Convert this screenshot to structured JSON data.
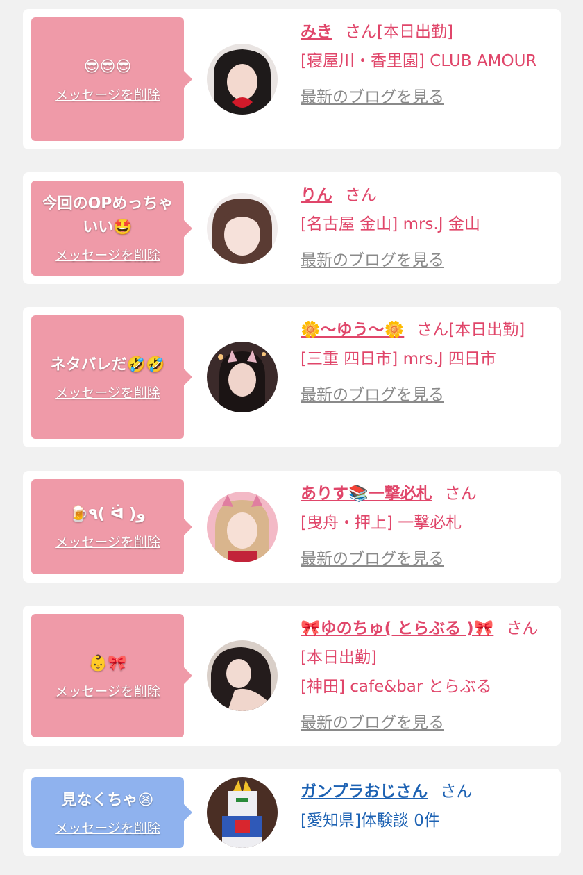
{
  "items": [
    {
      "message": "😎😎😎",
      "delete_label": "メッセージを削除",
      "name": "みき",
      "honorific": "さん[本日出勤]",
      "location": "[寝屋川・香里園] CLUB AMOUR",
      "blog_label": "最新のブログを見る",
      "theme": "pink"
    },
    {
      "message": "今回のOPめっちゃいい🤩",
      "delete_label": "メッセージを削除",
      "name": "りん",
      "honorific": "さん",
      "location": "[名古屋 金山] mrs.J 金山",
      "blog_label": "最新のブログを見る",
      "theme": "pink"
    },
    {
      "message": "ネタバレだ🤣🤣",
      "delete_label": "メッセージを削除",
      "name": "🌼〜ゆう〜🌼",
      "honorific": "さん[本日出勤]",
      "location": "[三重 四日市] mrs.J 四日市",
      "blog_label": "最新のブログを見る",
      "theme": "pink"
    },
    {
      "message": "🍺٩( ᐛ )و",
      "delete_label": "メッセージを削除",
      "name": "ありす📚一撃必札",
      "honorific": "さん",
      "location": "[曳舟・押上] 一撃必札",
      "blog_label": "最新のブログを見る",
      "theme": "pink"
    },
    {
      "message": "👶🎀",
      "delete_label": "メッセージを削除",
      "name": "🎀ゆのちゅ( とらぶる )🎀",
      "honorific": "さん[本日出勤]",
      "location": "[神田] cafe&bar とらぶる",
      "blog_label": "最新のブログを見る",
      "theme": "pink"
    },
    {
      "message": "見なくちゃ😫",
      "delete_label": "メッセージを削除",
      "name": "ガンプラおじさん",
      "honorific": "さん",
      "location": "[愛知県]体験談 0件",
      "theme": "blue"
    }
  ]
}
